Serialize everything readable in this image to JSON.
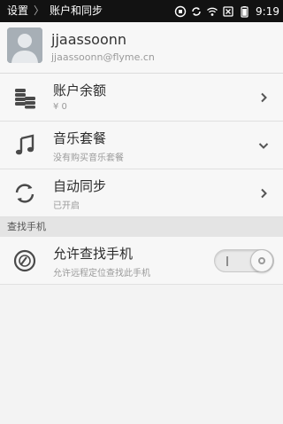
{
  "statusbar": {
    "breadcrumb_parent": "设置",
    "breadcrumb_current": "账户和同步",
    "time": "9:19"
  },
  "account": {
    "username": "jjaassoonn",
    "email": "jjaassoonn@flyme.cn"
  },
  "rows": [
    {
      "title": "账户余额",
      "subtitle": "¥ 0",
      "icon": "coins-icon",
      "arrow": "chevron-right-icon"
    },
    {
      "title": "音乐套餐",
      "subtitle": "没有购买音乐套餐",
      "icon": "music-note-icon",
      "arrow": "chevron-down-icon"
    },
    {
      "title": "自动同步",
      "subtitle": "已开启",
      "icon": "sync-icon",
      "arrow": "chevron-right-icon"
    }
  ],
  "find_phone": {
    "section_header": "查找手机",
    "title": "允许查找手机",
    "subtitle": "允许远程定位查找此手机",
    "toggle_on": true
  },
  "colors": {
    "statusbar_bg": "#121212",
    "row_bg": "#f7f7f7",
    "section_bg": "#e4e4e4"
  }
}
